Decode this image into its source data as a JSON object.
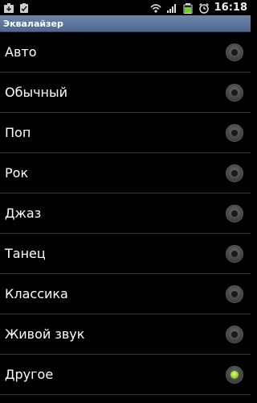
{
  "status_bar": {
    "time": "16:18",
    "icons": [
      "download-icon",
      "checklist-icon",
      "wifi-icon",
      "signal-icon",
      "battery-icon",
      "alarm-icon"
    ]
  },
  "title": "Эквалайзер",
  "options": [
    {
      "label": "Авто",
      "selected": false
    },
    {
      "label": "Обычный",
      "selected": false
    },
    {
      "label": "Поп",
      "selected": false
    },
    {
      "label": "Рок",
      "selected": false
    },
    {
      "label": "Джаз",
      "selected": false
    },
    {
      "label": "Танец",
      "selected": false
    },
    {
      "label": "Классика",
      "selected": false
    },
    {
      "label": "Живой звук",
      "selected": false
    },
    {
      "label": "Другое",
      "selected": true
    }
  ],
  "colors": {
    "title_bar": "#5b7398",
    "radio_selected": "#8fd21c",
    "background": "#000000"
  }
}
